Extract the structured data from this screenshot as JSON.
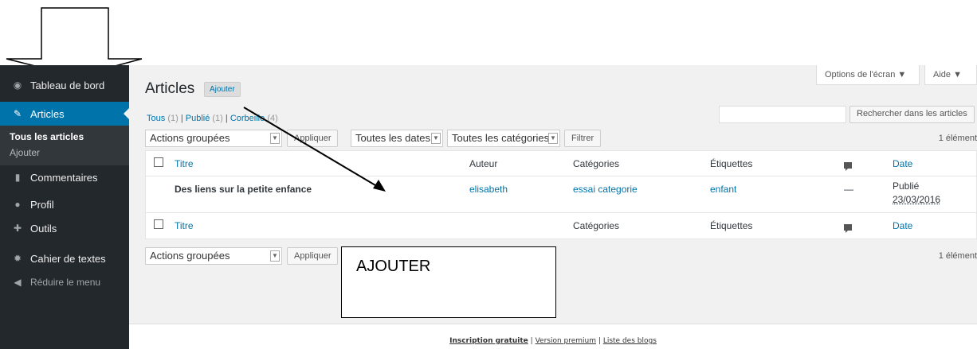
{
  "sidebar": {
    "items": [
      {
        "label": "Tableau de bord",
        "icon": "dashboard-icon"
      },
      {
        "label": "Articles",
        "icon": "pin-icon"
      },
      {
        "label": "Commentaires",
        "icon": "comment-icon"
      },
      {
        "label": "Profil",
        "icon": "user-icon"
      },
      {
        "label": "Outils",
        "icon": "wrench-icon"
      },
      {
        "label": "Cahier de textes",
        "icon": "gear-icon"
      },
      {
        "label": "Réduire le menu",
        "icon": "collapse-icon"
      }
    ],
    "submenu": [
      "Tous les articles",
      "Ajouter"
    ]
  },
  "header": {
    "screen_options": "Options de l'écran ▼",
    "help": "Aide ▼",
    "title": "Articles",
    "add_button": "Ajouter"
  },
  "filters": {
    "all": "Tous",
    "all_count": "(1)",
    "published": "Publié",
    "published_count": "(1)",
    "trash": "Corbeille",
    "trash_count": "(4)",
    "sep": "|"
  },
  "search": {
    "button": "Rechercher dans les articles"
  },
  "toolbar": {
    "bulk_actions": "Actions groupées",
    "apply": "Appliquer",
    "dates": "Toutes les dates",
    "categories": "Toutes les catégories",
    "filter": "Filtrer",
    "count": "1 élément"
  },
  "table": {
    "columns": {
      "title": "Titre",
      "author": "Auteur",
      "categories": "Catégories",
      "tags": "Étiquettes",
      "date": "Date"
    },
    "rows": [
      {
        "title": "Des liens sur la petite enfance",
        "author": "elisabeth",
        "category": "essai categorie",
        "tags": "enfant",
        "comments": "—",
        "status": "Publié",
        "date": "23/03/2016"
      }
    ]
  },
  "annotation": {
    "label": "AJOUTER"
  },
  "footer": {
    "signup": "Inscription gratuite",
    "premium": "Version premium",
    "blogs": "Liste des blogs",
    "sep": "|"
  }
}
